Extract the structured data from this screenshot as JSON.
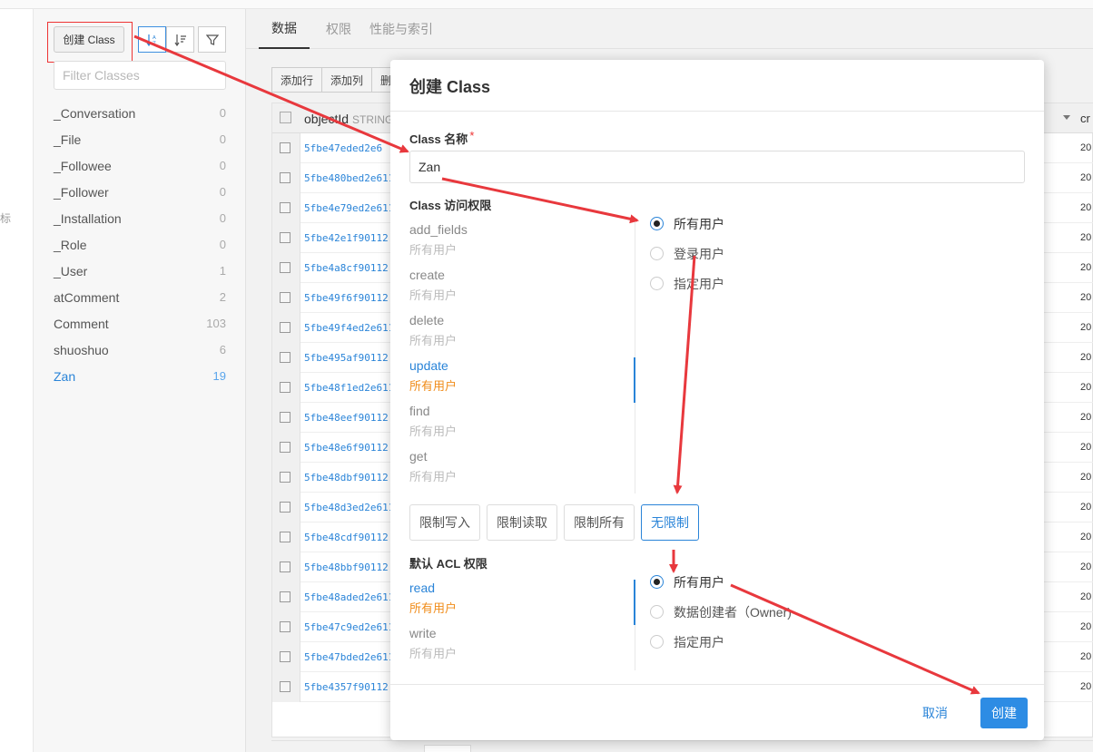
{
  "sidebar": {
    "create_label": "创建 Class",
    "filter_placeholder": "Filter Classes",
    "side_glyph": "标",
    "classes": [
      {
        "name": "_Conversation",
        "count": "0"
      },
      {
        "name": "_File",
        "count": "0"
      },
      {
        "name": "_Followee",
        "count": "0"
      },
      {
        "name": "_Follower",
        "count": "0"
      },
      {
        "name": "_Installation",
        "count": "0"
      },
      {
        "name": "_Role",
        "count": "0"
      },
      {
        "name": "_User",
        "count": "1"
      },
      {
        "name": "atComment",
        "count": "2"
      },
      {
        "name": "Comment",
        "count": "103"
      },
      {
        "name": "shuoshuo",
        "count": "6"
      },
      {
        "name": "Zan",
        "count": "19"
      }
    ]
  },
  "tabs": [
    "数据",
    "权限",
    "性能与索引"
  ],
  "toolbar": {
    "add_row": "添加行",
    "add_col": "添加列",
    "more": "删"
  },
  "grid": {
    "col_name": "objectId",
    "col_type": "STRING",
    "col2": "cr",
    "rows": [
      {
        "id": "5fbe47eded2e6",
        "year": "20"
      },
      {
        "id": "5fbe480bed2e611",
        "year": "20"
      },
      {
        "id": "5fbe4e79ed2e611",
        "year": "20"
      },
      {
        "id": "5fbe42e1f90112",
        "year": "20"
      },
      {
        "id": "5fbe4a8cf90112",
        "year": "20"
      },
      {
        "id": "5fbe49f6f90112",
        "year": "20"
      },
      {
        "id": "5fbe49f4ed2e611",
        "year": "20"
      },
      {
        "id": "5fbe495af90112",
        "year": "20"
      },
      {
        "id": "5fbe48f1ed2e611",
        "year": "20"
      },
      {
        "id": "5fbe48eef90112",
        "year": "20"
      },
      {
        "id": "5fbe48e6f90112",
        "year": "20"
      },
      {
        "id": "5fbe48dbf90112",
        "year": "20"
      },
      {
        "id": "5fbe48d3ed2e611",
        "year": "20"
      },
      {
        "id": "5fbe48cdf90112",
        "year": "20"
      },
      {
        "id": "5fbe48bbf90112",
        "year": "20"
      },
      {
        "id": "5fbe48aded2e611",
        "year": "20"
      },
      {
        "id": "5fbe47c9ed2e611",
        "year": "20"
      },
      {
        "id": "5fbe47bded2e611",
        "year": "20"
      },
      {
        "id": "5fbe4357f90112",
        "year": "20"
      }
    ]
  },
  "modal": {
    "title": "创建 Class",
    "name_label": "Class 名称",
    "required_mark": "*",
    "name_value": "Zan",
    "access_label": "Class 访问权限",
    "permissions": [
      {
        "name": "add_fields",
        "value": "所有用户"
      },
      {
        "name": "create",
        "value": "所有用户"
      },
      {
        "name": "delete",
        "value": "所有用户"
      },
      {
        "name": "update",
        "value": "所有用户"
      },
      {
        "name": "find",
        "value": "所有用户"
      },
      {
        "name": "get",
        "value": "所有用户"
      }
    ],
    "access_options": [
      "所有用户",
      "登录用户",
      "指定用户"
    ],
    "limit_buttons": [
      "限制写入",
      "限制读取",
      "限制所有",
      "无限制"
    ],
    "acl_label": "默认 ACL 权限",
    "acl": [
      {
        "name": "read",
        "value": "所有用户"
      },
      {
        "name": "write",
        "value": "所有用户"
      }
    ],
    "acl_options": [
      "所有用户",
      "数据创建者（Owner)",
      "指定用户"
    ],
    "cancel_label": "取消",
    "submit_label": "创建"
  },
  "colors": {
    "accent": "#2a84d8",
    "highlight": "#f08c1a",
    "annotation": "#e8383d",
    "primary_button": "#2d8ce4"
  }
}
